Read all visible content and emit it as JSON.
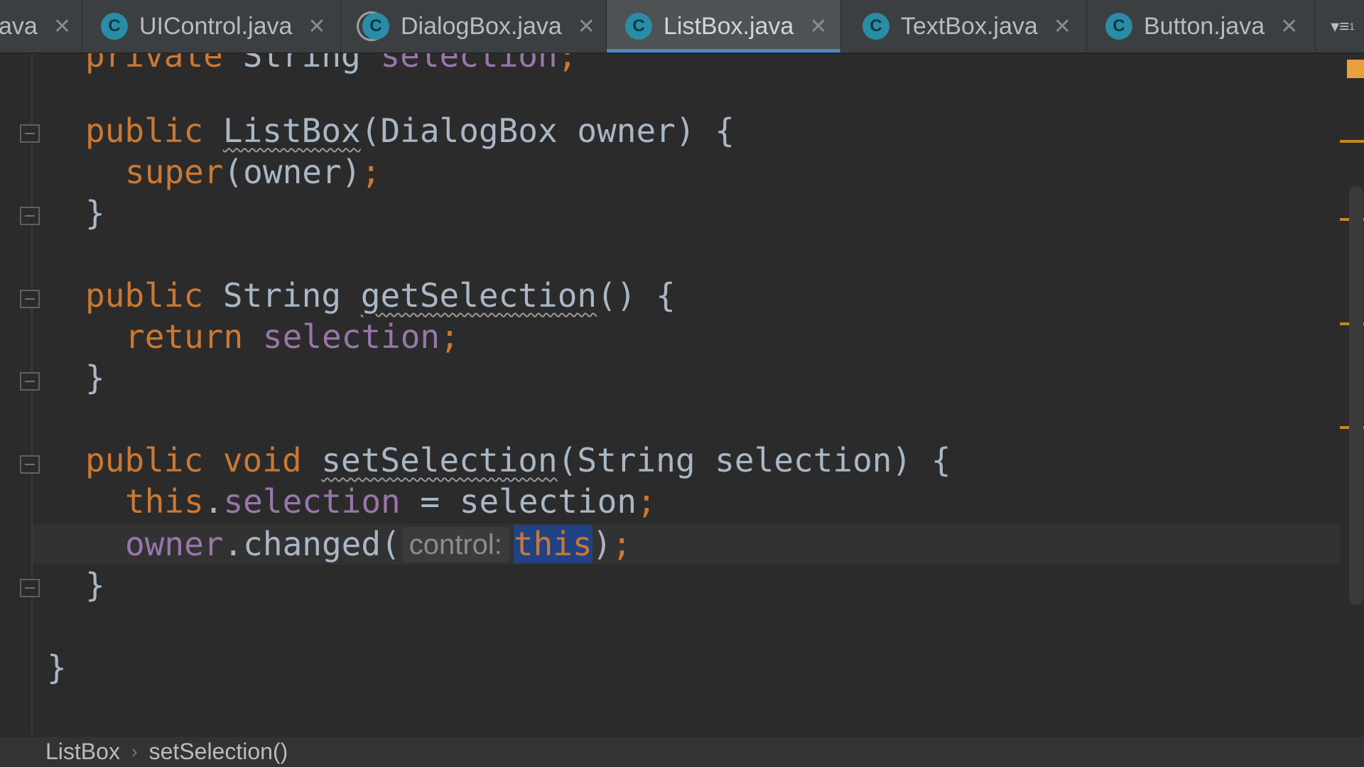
{
  "tabs": [
    {
      "label": "ava",
      "icon": "class-icon",
      "active": false
    },
    {
      "label": "UIControl.java",
      "icon": "class-icon",
      "active": false
    },
    {
      "label": "DialogBox.java",
      "icon": "class-icon",
      "active": false
    },
    {
      "label": "ListBox.java",
      "icon": "class-icon",
      "active": true
    },
    {
      "label": "TextBox.java",
      "icon": "class-icon",
      "active": false
    },
    {
      "label": "Button.java",
      "icon": "class-icon",
      "active": false
    }
  ],
  "tab_icon_letter": "C",
  "tab_close_glyph": "✕",
  "overflow": {
    "glyph": "▾≡",
    "count": "1"
  },
  "code": {
    "l0": {
      "kw": "private ",
      "type": "String ",
      "field": "selection",
      "end": ";"
    },
    "l1": {
      "kw": "public ",
      "name": "ListBox",
      "args": "(DialogBox owner) {"
    },
    "l2": {
      "kw": "super",
      "rest": "(owner)",
      "semi": ";"
    },
    "l3": {
      "brace": "}"
    },
    "l4": {
      "kw": "public ",
      "type": "String ",
      "name": "getSelection",
      "args": "() {"
    },
    "l5": {
      "kw": "return ",
      "field": "selection",
      "semi": ";"
    },
    "l6": {
      "brace": "}"
    },
    "l7": {
      "kw": "public void ",
      "name": "setSelection",
      "args": "(String selection) {"
    },
    "l8": {
      "kw": "this",
      "dot": ".",
      "field": "selection",
      "rest": " = selection",
      "semi": ";"
    },
    "l9": {
      "obj": "owner",
      "call": ".changed(",
      "hint": "control:",
      "arg": "this",
      "close": ")",
      "semi": ";"
    },
    "l10": {
      "brace": "}"
    },
    "l11": {
      "brace": "}"
    }
  },
  "breadcrumb": {
    "class": "ListBox",
    "sep": "›",
    "method": "setSelection()"
  },
  "colors": {
    "keyword": "#cc7832",
    "field": "#9876aa",
    "text": "#a9b7c6",
    "selection": "#214283",
    "marker": "#e8a13a"
  }
}
